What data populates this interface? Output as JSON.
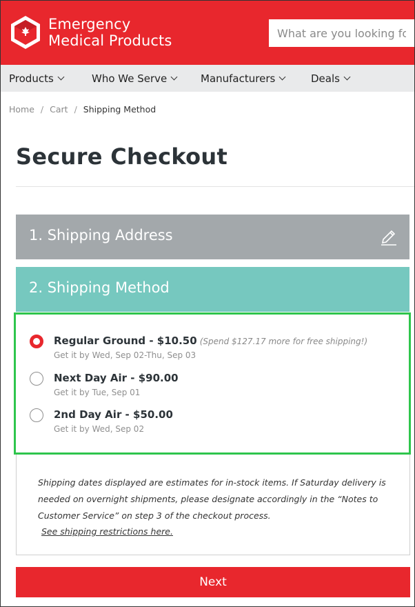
{
  "header": {
    "brand_line1": "Emergency",
    "brand_line2": "Medical Products",
    "search_placeholder": "What are you looking for?",
    "brand_color": "#e8272d"
  },
  "nav": {
    "items": [
      {
        "label": "Products"
      },
      {
        "label": "Who We Serve"
      },
      {
        "label": "Manufacturers"
      },
      {
        "label": "Deals"
      }
    ]
  },
  "breadcrumb": {
    "items": [
      "Home",
      "Cart",
      "Shipping Method"
    ],
    "separator": "/"
  },
  "page": {
    "title": "Secure Checkout"
  },
  "steps": {
    "shipping_address": {
      "label": "1. Shipping Address",
      "icon": "pencil-icon"
    },
    "shipping_method": {
      "label": "2. Shipping Method"
    }
  },
  "shipping_options": [
    {
      "name": "Regular Ground - $10.50",
      "note": "(Spend $127.17 more for free shipping!)",
      "eta": "Get it by Wed, Sep 02-Thu, Sep 03",
      "selected": true
    },
    {
      "name": "Next Day Air - $90.00",
      "note": "",
      "eta": "Get it by Tue, Sep 01",
      "selected": false
    },
    {
      "name": "2nd Day Air - $50.00",
      "note": "",
      "eta": "Get it by Wed, Sep 02",
      "selected": false
    }
  ],
  "info": {
    "text": "Shipping dates displayed are estimates for in-stock items. If Saturday delivery is needed on overnight shipments, please designate accordingly in the “Notes to Customer Service” on step 3 of the checkout process.",
    "link": "See shipping restrictions here."
  },
  "actions": {
    "next_label": "Next"
  }
}
